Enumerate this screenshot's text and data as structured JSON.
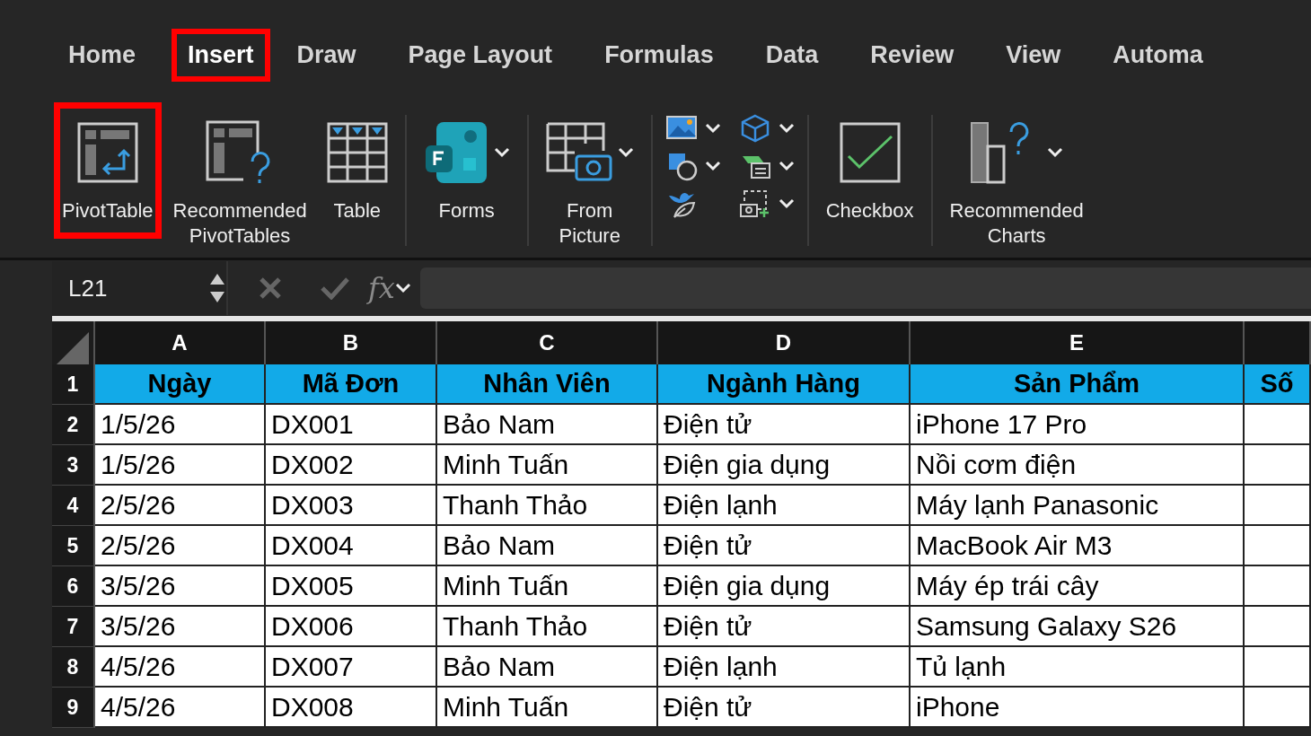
{
  "tabs": [
    {
      "label": "Home",
      "selected": false,
      "highlighted": false
    },
    {
      "label": "Insert",
      "selected": true,
      "highlighted": true
    },
    {
      "label": "Draw",
      "selected": false,
      "highlighted": false
    },
    {
      "label": "Page Layout",
      "selected": false,
      "highlighted": false
    },
    {
      "label": "Formulas",
      "selected": false,
      "highlighted": false
    },
    {
      "label": "Data",
      "selected": false,
      "highlighted": false
    },
    {
      "label": "Review",
      "selected": false,
      "highlighted": false
    },
    {
      "label": "View",
      "selected": false,
      "highlighted": false
    },
    {
      "label": "Automa",
      "selected": false,
      "highlighted": false
    }
  ],
  "ribbon": [
    {
      "kind": "button",
      "label": "PivotTable",
      "highlighted": true,
      "has_menu": false
    },
    {
      "kind": "button",
      "label": "Recommended\nPivotTables",
      "highlighted": false,
      "has_menu": false
    },
    {
      "kind": "button",
      "label": "Table",
      "highlighted": false,
      "has_menu": false
    },
    {
      "kind": "separator"
    },
    {
      "kind": "button",
      "label": "Forms",
      "highlighted": false,
      "has_menu": true
    },
    {
      "kind": "separator"
    },
    {
      "kind": "button",
      "label": "From\nPicture",
      "highlighted": false,
      "has_menu": true
    },
    {
      "kind": "separator"
    },
    {
      "kind": "icon-grid"
    },
    {
      "kind": "separator"
    },
    {
      "kind": "button",
      "label": "Checkbox",
      "highlighted": false,
      "has_menu": false
    },
    {
      "kind": "separator"
    },
    {
      "kind": "button",
      "label": "Recommended\nCharts",
      "highlighted": false,
      "has_menu": true
    }
  ],
  "formula_bar": {
    "name_box": "L21",
    "fx": "fx"
  },
  "sheet": {
    "columns": [
      "A",
      "B",
      "C",
      "D",
      "E",
      ""
    ],
    "rows": [
      {
        "number": "1",
        "kind": "header",
        "cells": [
          "Ngày",
          "Mã Đơn",
          "Nhân Viên",
          "Ngành Hàng",
          "Sản Phẩm",
          "Số"
        ]
      },
      {
        "number": "2",
        "kind": "data",
        "cells": [
          "1/5/26",
          "DX001",
          "Bảo Nam",
          "Điện tử",
          "iPhone 17 Pro",
          ""
        ]
      },
      {
        "number": "3",
        "kind": "data",
        "cells": [
          "1/5/26",
          "DX002",
          "Minh Tuấn",
          "Điện gia dụng",
          "Nồi cơm điện",
          ""
        ]
      },
      {
        "number": "4",
        "kind": "data",
        "cells": [
          "2/5/26",
          "DX003",
          "Thanh Thảo",
          "Điện lạnh",
          "Máy lạnh Panasonic",
          ""
        ]
      },
      {
        "number": "5",
        "kind": "data",
        "cells": [
          "2/5/26",
          "DX004",
          "Bảo Nam",
          "Điện tử",
          "MacBook Air M3",
          ""
        ]
      },
      {
        "number": "6",
        "kind": "data",
        "cells": [
          "3/5/26",
          "DX005",
          "Minh Tuấn",
          "Điện gia dụng",
          "Máy ép trái cây",
          ""
        ]
      },
      {
        "number": "7",
        "kind": "data",
        "cells": [
          "3/5/26",
          "DX006",
          "Thanh Thảo",
          "Điện tử",
          "Samsung Galaxy S26",
          ""
        ]
      },
      {
        "number": "8",
        "kind": "data",
        "cells": [
          "4/5/26",
          "DX007",
          "Bảo Nam",
          "Điện lạnh",
          "Tủ lạnh",
          ""
        ]
      },
      {
        "number": "9",
        "kind": "data",
        "cells": [
          "4/5/26",
          "DX008",
          "Minh Tuấn",
          "Điện tử",
          "iPhone",
          ""
        ]
      }
    ]
  }
}
